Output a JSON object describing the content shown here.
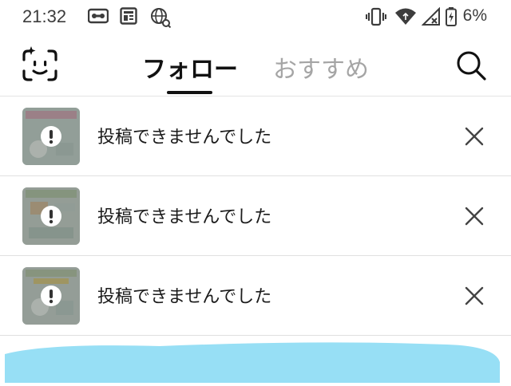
{
  "status_bar": {
    "time": "21:32",
    "left_icons": [
      "voicemail-icon",
      "news-icon",
      "vpn-globe-icon"
    ],
    "right_icons": [
      "vibrate-icon",
      "wifi-icon",
      "no-signal-icon",
      "battery-charging-icon"
    ],
    "battery_percent": "6%"
  },
  "header": {
    "left_icon": "face-scan-sparkle-icon",
    "tabs": [
      {
        "label": "フォロー",
        "active": true
      },
      {
        "label": "おすすめ",
        "active": false
      }
    ],
    "right_icon": "search-icon"
  },
  "posts": [
    {
      "message": "投稿できませんでした",
      "status_icon": "exclamation-icon",
      "dismiss_icon": "close-icon"
    },
    {
      "message": "投稿できませんでした",
      "status_icon": "exclamation-icon",
      "dismiss_icon": "close-icon"
    },
    {
      "message": "投稿できませんでした",
      "status_icon": "exclamation-icon",
      "dismiss_icon": "close-icon"
    }
  ],
  "colors": {
    "active_tab": "#111111",
    "inactive_tab": "#a5a5a5",
    "banner": "#97dff5"
  }
}
